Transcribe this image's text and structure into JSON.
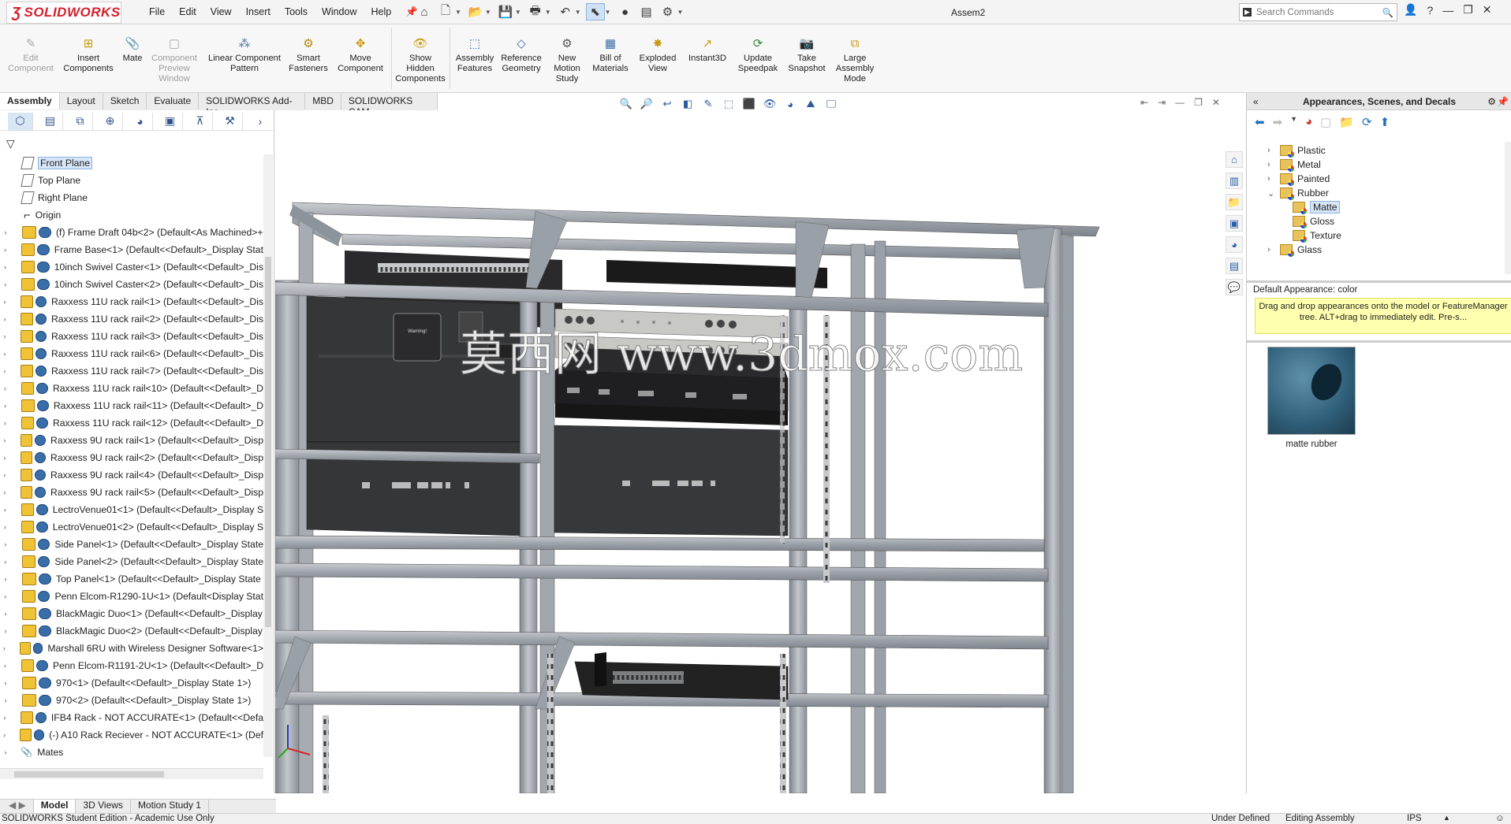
{
  "app": {
    "brand": "SOLIDWORKS",
    "doc_title": "Assem2"
  },
  "menu": [
    "File",
    "Edit",
    "View",
    "Insert",
    "Tools",
    "Window",
    "Help"
  ],
  "search": {
    "placeholder": "Search Commands"
  },
  "commands": [
    {
      "label": "Edit Component",
      "dim": true
    },
    {
      "label": "Insert Components"
    },
    {
      "label": "Mate"
    },
    {
      "label": "Component Preview Window",
      "dim": true
    },
    {
      "label": "Linear Component Pattern"
    },
    {
      "label": "Smart Fasteners"
    },
    {
      "label": "Move Component"
    },
    {
      "label": "Show Hidden Components"
    },
    {
      "label": "Assembly Features"
    },
    {
      "label": "Reference Geometry"
    },
    {
      "label": "New Motion Study"
    },
    {
      "label": "Bill of Materials"
    },
    {
      "label": "Exploded View"
    },
    {
      "label": "Instant3D"
    },
    {
      "label": "Update Speedpak"
    },
    {
      "label": "Take Snapshot"
    },
    {
      "label": "Large Assembly Mode"
    }
  ],
  "tabs": [
    "Assembly",
    "Layout",
    "Sketch",
    "Evaluate",
    "SOLIDWORKS Add-Ins",
    "MBD",
    "SOLIDWORKS CAM"
  ],
  "tree": [
    {
      "label": "Front Plane",
      "type": "plane",
      "selected": true
    },
    {
      "label": "Top Plane",
      "type": "plane"
    },
    {
      "label": "Right Plane",
      "type": "plane"
    },
    {
      "label": "Origin",
      "type": "origin"
    },
    {
      "label": "(f) Frame Draft 04b<2> (Default<As Machined>+",
      "type": "part"
    },
    {
      "label": "Frame Base<1> (Default<<Default>_Display Stat",
      "type": "part"
    },
    {
      "label": "10inch Swivel Caster<1> (Default<<Default>_Dis",
      "type": "part"
    },
    {
      "label": "10inch Swivel Caster<2> (Default<<Default>_Dis",
      "type": "part"
    },
    {
      "label": "Raxxess 11U rack rail<1> (Default<<Default>_Dis",
      "type": "part"
    },
    {
      "label": "Raxxess 11U rack rail<2> (Default<<Default>_Dis",
      "type": "part"
    },
    {
      "label": "Raxxess 11U rack rail<3> (Default<<Default>_Dis",
      "type": "part"
    },
    {
      "label": "Raxxess 11U rack rail<6> (Default<<Default>_Dis",
      "type": "part"
    },
    {
      "label": "Raxxess 11U rack rail<7> (Default<<Default>_Dis",
      "type": "part"
    },
    {
      "label": "Raxxess 11U rack rail<10> (Default<<Default>_D",
      "type": "part"
    },
    {
      "label": "Raxxess 11U rack rail<11> (Default<<Default>_D",
      "type": "part"
    },
    {
      "label": "Raxxess 11U rack rail<12> (Default<<Default>_D",
      "type": "part"
    },
    {
      "label": "Raxxess 9U rack rail<1> (Default<<Default>_Disp",
      "type": "part"
    },
    {
      "label": "Raxxess 9U rack rail<2> (Default<<Default>_Disp",
      "type": "part"
    },
    {
      "label": "Raxxess 9U rack rail<4> (Default<<Default>_Disp",
      "type": "part"
    },
    {
      "label": "Raxxess 9U rack rail<5> (Default<<Default>_Disp",
      "type": "part"
    },
    {
      "label": "LectroVenue01<1> (Default<<Default>_Display S",
      "type": "part"
    },
    {
      "label": "LectroVenue01<2> (Default<<Default>_Display S",
      "type": "part"
    },
    {
      "label": "Side Panel<1> (Default<<Default>_Display State",
      "type": "part"
    },
    {
      "label": "Side Panel<2> (Default<<Default>_Display State",
      "type": "part"
    },
    {
      "label": "Top Panel<1> (Default<<Default>_Display State",
      "type": "part"
    },
    {
      "label": "Penn Elcom-R1290-1U<1> (Default<Display Stat",
      "type": "part"
    },
    {
      "label": "BlackMagic Duo<1> (Default<<Default>_Display",
      "type": "part"
    },
    {
      "label": "BlackMagic Duo<2> (Default<<Default>_Display",
      "type": "part"
    },
    {
      "label": "Marshall 6RU with Wireless Designer Software<1>",
      "type": "part"
    },
    {
      "label": "Penn Elcom-R1191-2U<1> (Default<<Default>_D",
      "type": "part"
    },
    {
      "label": "970<1> (Default<<Default>_Display State 1>)",
      "type": "part"
    },
    {
      "label": "970<2> (Default<<Default>_Display State 1>)",
      "type": "part"
    },
    {
      "label": "IFB4 Rack - NOT ACCURATE<1> (Default<<Defa",
      "type": "part"
    },
    {
      "label": "(-) A10 Rack Reciever - NOT ACCURATE<1> (Def",
      "type": "part"
    },
    {
      "label": "Mates",
      "type": "mates"
    }
  ],
  "taskpane": {
    "title": "Appearances, Scenes, and Decals",
    "tree": [
      {
        "label": "Plastic",
        "level": 0,
        "expander": "›"
      },
      {
        "label": "Metal",
        "level": 0,
        "expander": "›"
      },
      {
        "label": "Painted",
        "level": 0,
        "expander": "›"
      },
      {
        "label": "Rubber",
        "level": 0,
        "expander": "⌄"
      },
      {
        "label": "Matte",
        "level": 1,
        "selected": true
      },
      {
        "label": "Gloss",
        "level": 1
      },
      {
        "label": "Texture",
        "level": 1
      },
      {
        "label": "Glass",
        "level": 0,
        "expander": "›"
      }
    ],
    "default_appearance": "Default Appearance: color",
    "hint": "Drag and drop appearances onto the model or FeatureManager tree.  ALT+drag to immediately edit.  Pre-s...",
    "swatch_label": "matte rubber"
  },
  "watermark": "莫西网 www.3dmox.com",
  "bottom_tabs": [
    "Model",
    "3D Views",
    "Motion Study 1"
  ],
  "status": {
    "left": "SOLIDWORKS Student Edition - Academic Use Only",
    "state": "Under Defined",
    "mode": "Editing Assembly",
    "units": "IPS"
  },
  "colors": {
    "brand_red": "#d51f2a",
    "selection": "#d7e6f7",
    "frame_gray": "#a9adb3",
    "hint_yellow": "#ffffb0"
  }
}
